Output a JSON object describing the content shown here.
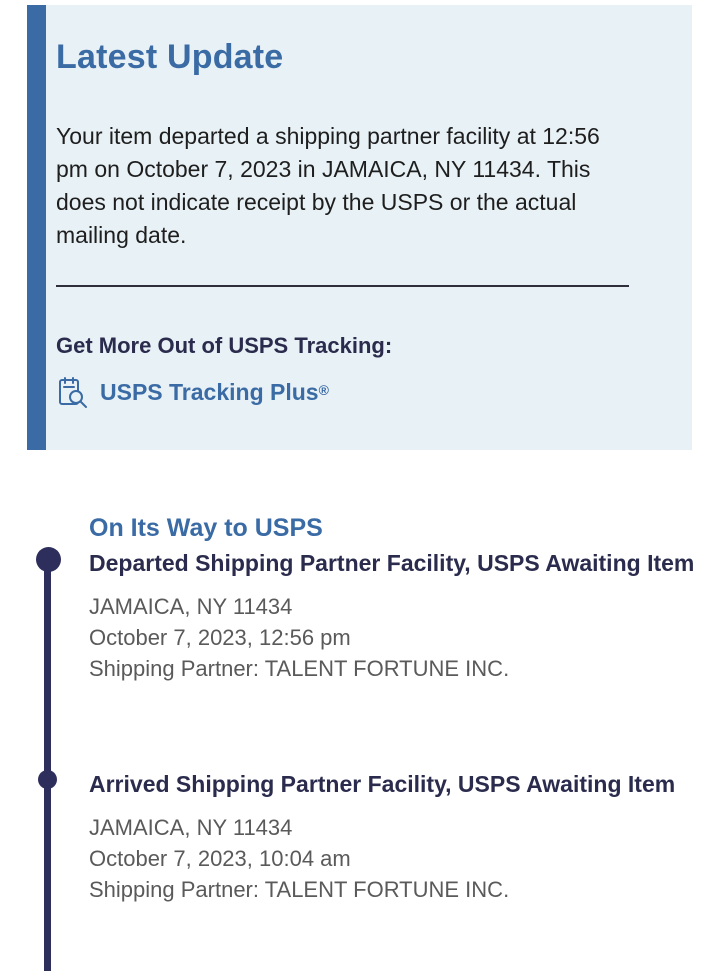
{
  "latest_update": {
    "title": "Latest Update",
    "message": "Your item departed a shipping partner facility at 12:56 pm on October 7, 2023 in JAMAICA, NY 11434. This does not indicate receipt by the USPS or the actual mailing date.",
    "promo_heading": "Get More Out of USPS Tracking:",
    "promo_link_label": "USPS Tracking Plus",
    "promo_link_mark": "®",
    "promo_icon": "tracking-plus-icon"
  },
  "timeline": {
    "status_label": "On Its Way to USPS",
    "events": [
      {
        "title": "Departed Shipping Partner Facility, USPS Awaiting Item",
        "location": "JAMAICA, NY 11434",
        "datetime": "October 7, 2023, 12:56 pm",
        "partner": "Shipping Partner: TALENT FORTUNE INC."
      },
      {
        "title": "Arrived Shipping Partner Facility, USPS Awaiting Item",
        "location": "JAMAICA, NY 11434",
        "datetime": "October 7, 2023, 10:04 am",
        "partner": "Shipping Partner: TALENT FORTUNE INC."
      }
    ]
  },
  "colors": {
    "accent_blue": "#3a6ba5",
    "navy": "#2b2c4d",
    "card_background": "#e8f1f5",
    "timeline": "#2e2e5c",
    "detail_text": "#5a5a5a"
  }
}
